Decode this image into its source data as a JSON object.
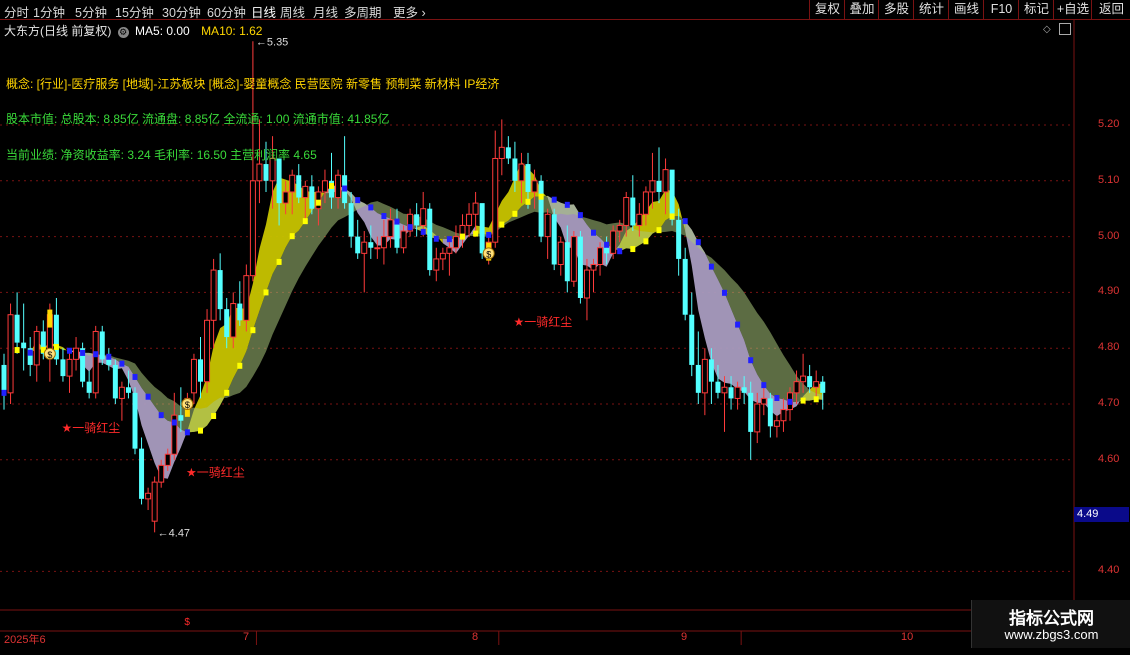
{
  "toolbar": {
    "periods": [
      "分时",
      "1分钟",
      "5分钟",
      "15分钟",
      "30分钟",
      "60分钟",
      "日线",
      "周线",
      "月线",
      "多周期",
      "更多"
    ],
    "active_period": "日线",
    "right_buttons": [
      "复权",
      "叠加",
      "多股",
      "统计",
      "画线",
      "F10",
      "标记",
      "+自选",
      "返回"
    ]
  },
  "header": {
    "stock_title": "大东方(日线 前复权)",
    "ma5_label": "MA5: 0.00",
    "ma10_label": "MA10: 1.62"
  },
  "info": {
    "concepts": "概念: [行业]-医疗服务 [地域]-江苏板块 [概念]-婴童概念 民营医院 新零售 预制菜 新材料 IP经济",
    "capital": "股本市值: 总股本: 8.85亿 流通盘: 8.85亿 全流通: 1.00 流通市值: 41.85亿",
    "performance": "当前业绩: 净资收益率: 3.24 毛利率: 16.50 主营利润率 4.65"
  },
  "annotations": {
    "high_label": "5.35",
    "low_label": "4.47",
    "signal_text": "★一骑红尘",
    "coin_symbol": "$"
  },
  "axis": {
    "y_ticks": [
      "5.20",
      "5.10",
      "5.00",
      "4.90",
      "4.80",
      "4.70",
      "4.60",
      "4.40"
    ],
    "current_price": "4.49",
    "x_labels": [
      "2025年6",
      "7",
      "8",
      "9",
      "10"
    ]
  },
  "watermark": {
    "line1": "指标公式网",
    "line2": "www.zbgs3.com"
  },
  "colors": {
    "up": "#ff3b3b",
    "down": "#54ffff",
    "yellow_candle": "#ffd700",
    "grid": "#7a1212",
    "ribbon_yellow": "#c8c400",
    "ribbon_green": "#7fd08a",
    "ribbon_olive": "#a7c47a",
    "ribbon_lavender": "#a99cc0",
    "dot_blue": "#2020ff",
    "dot_yellow": "#ffff00",
    "text_yellow": "#ffd400",
    "text_green": "#3adb3a"
  },
  "chart_data": {
    "type": "candlestick",
    "ylim": [
      4.35,
      5.45
    ],
    "y_ticks": [
      5.2,
      5.1,
      5.0,
      4.9,
      4.8,
      4.7,
      4.6,
      4.4
    ],
    "months": [
      "2025年6",
      "7",
      "8",
      "9",
      "10"
    ],
    "month_start_index": [
      0,
      39,
      76,
      113,
      158
    ],
    "candles_ohlc": [
      [
        4.77,
        4.79,
        4.69,
        4.72
      ],
      [
        4.72,
        4.88,
        4.7,
        4.86
      ],
      [
        4.86,
        4.9,
        4.79,
        4.81
      ],
      [
        4.81,
        4.88,
        4.76,
        4.8
      ],
      [
        4.8,
        4.82,
        4.75,
        4.77
      ],
      [
        4.77,
        4.84,
        4.74,
        4.83
      ],
      [
        4.83,
        4.85,
        4.78,
        4.79
      ],
      [
        4.79,
        4.88,
        4.74,
        4.86
      ],
      [
        4.86,
        4.89,
        4.77,
        4.78
      ],
      [
        4.78,
        4.8,
        4.74,
        4.75
      ],
      [
        4.75,
        4.8,
        4.72,
        4.78
      ],
      [
        4.78,
        4.82,
        4.76,
        4.8
      ],
      [
        4.8,
        4.81,
        4.73,
        4.74
      ],
      [
        4.74,
        4.76,
        4.71,
        4.72
      ],
      [
        4.72,
        4.84,
        4.71,
        4.83
      ],
      [
        4.83,
        4.84,
        4.77,
        4.78
      ],
      [
        4.78,
        4.8,
        4.76,
        4.77
      ],
      [
        4.77,
        4.78,
        4.7,
        4.71
      ],
      [
        4.71,
        4.74,
        4.67,
        4.73
      ],
      [
        4.73,
        4.76,
        4.71,
        4.72
      ],
      [
        4.72,
        4.73,
        4.61,
        4.62
      ],
      [
        4.62,
        4.64,
        4.52,
        4.53
      ],
      [
        4.53,
        4.55,
        4.51,
        4.54
      ],
      [
        4.49,
        4.57,
        4.47,
        4.56
      ],
      [
        4.56,
        4.6,
        4.55,
        4.59
      ],
      [
        4.59,
        4.62,
        4.58,
        4.61
      ],
      [
        4.61,
        4.72,
        4.6,
        4.68
      ],
      [
        4.68,
        4.73,
        4.65,
        4.67
      ],
      [
        4.7,
        4.72,
        4.68,
        4.71
      ],
      [
        4.72,
        4.79,
        4.7,
        4.78
      ],
      [
        4.78,
        4.82,
        4.71,
        4.74
      ],
      [
        4.74,
        4.87,
        4.72,
        4.85
      ],
      [
        4.85,
        4.96,
        4.8,
        4.94
      ],
      [
        4.94,
        4.97,
        4.85,
        4.87
      ],
      [
        4.87,
        4.89,
        4.8,
        4.82
      ],
      [
        4.82,
        4.9,
        4.8,
        4.88
      ],
      [
        4.88,
        4.92,
        4.84,
        4.85
      ],
      [
        4.85,
        4.95,
        4.83,
        4.93
      ],
      [
        4.93,
        5.35,
        4.92,
        5.1
      ],
      [
        5.1,
        5.21,
        5.06,
        5.13
      ],
      [
        5.13,
        5.17,
        5.08,
        5.1
      ],
      [
        5.1,
        5.18,
        5.05,
        5.14
      ],
      [
        5.14,
        5.12,
        5.02,
        5.06
      ],
      [
        5.06,
        5.1,
        5.04,
        5.08
      ],
      [
        5.08,
        5.12,
        5.04,
        5.11
      ],
      [
        5.11,
        5.13,
        5.06,
        5.07
      ],
      [
        5.07,
        5.1,
        5.03,
        5.09
      ],
      [
        5.09,
        5.11,
        5.04,
        5.05
      ],
      [
        5.05,
        5.09,
        5.02,
        5.08
      ],
      [
        5.08,
        5.12,
        5.06,
        5.1
      ],
      [
        5.1,
        5.15,
        5.05,
        5.07
      ],
      [
        5.07,
        5.12,
        5.05,
        5.11
      ],
      [
        5.11,
        5.18,
        5.05,
        5.06
      ],
      [
        5.06,
        5.08,
        4.98,
        5.0
      ],
      [
        5.0,
        5.03,
        4.96,
        4.97
      ],
      [
        4.97,
        5.01,
        4.9,
        4.99
      ],
      [
        4.99,
        5.02,
        4.96,
        4.98
      ],
      [
        4.98,
        5.0,
        4.96,
        4.98
      ],
      [
        4.98,
        5.03,
        4.95,
        5.0
      ],
      [
        5.0,
        5.05,
        4.98,
        5.03
      ],
      [
        5.03,
        5.05,
        4.97,
        4.98
      ],
      [
        4.98,
        5.02,
        4.97,
        5.01
      ],
      [
        5.01,
        5.05,
        5.0,
        5.04
      ],
      [
        5.04,
        5.06,
        5.0,
        5.02
      ],
      [
        5.02,
        5.08,
        5.0,
        5.05
      ],
      [
        5.05,
        5.06,
        4.93,
        4.94
      ],
      [
        4.94,
        4.98,
        4.92,
        4.96
      ],
      [
        4.96,
        4.98,
        4.94,
        4.97
      ],
      [
        4.97,
        5.0,
        4.93,
        4.98
      ],
      [
        4.98,
        5.02,
        4.97,
        5.0
      ],
      [
        5.0,
        5.04,
        4.98,
        5.02
      ],
      [
        5.02,
        5.06,
        5.0,
        5.04
      ],
      [
        5.04,
        5.08,
        5.01,
        5.06
      ],
      [
        5.06,
        5.05,
        4.96,
        4.97
      ],
      [
        4.97,
        5.0,
        4.95,
        4.99
      ],
      [
        4.99,
        5.19,
        4.98,
        5.14
      ],
      [
        5.14,
        5.21,
        5.11,
        5.16
      ],
      [
        5.16,
        5.18,
        5.13,
        5.14
      ],
      [
        5.14,
        5.17,
        5.08,
        5.1
      ],
      [
        5.1,
        5.15,
        5.06,
        5.13
      ],
      [
        5.13,
        5.15,
        5.05,
        5.08
      ],
      [
        5.08,
        5.12,
        5.05,
        5.1
      ],
      [
        5.1,
        5.11,
        4.99,
        5.0
      ],
      [
        5.0,
        5.05,
        4.96,
        5.04
      ],
      [
        5.04,
        5.05,
        4.94,
        4.95
      ],
      [
        4.95,
        5.0,
        4.93,
        4.99
      ],
      [
        4.99,
        5.02,
        4.9,
        4.92
      ],
      [
        4.92,
        5.01,
        4.91,
        5.0
      ],
      [
        5.0,
        5.01,
        4.88,
        4.89
      ],
      [
        4.89,
        4.96,
        4.85,
        4.94
      ],
      [
        4.94,
        4.96,
        4.9,
        4.95
      ],
      [
        4.95,
        4.99,
        4.93,
        4.98
      ],
      [
        4.98,
        5.0,
        4.95,
        4.97
      ],
      [
        4.97,
        5.02,
        4.96,
        5.01
      ],
      [
        5.01,
        5.03,
        4.99,
        5.02
      ],
      [
        5.02,
        5.08,
        5.0,
        5.07
      ],
      [
        5.07,
        5.11,
        5.01,
        5.02
      ],
      [
        5.02,
        5.06,
        5.0,
        5.04
      ],
      [
        5.04,
        5.09,
        5.02,
        5.08
      ],
      [
        5.08,
        5.15,
        5.05,
        5.1
      ],
      [
        5.1,
        5.16,
        5.06,
        5.08
      ],
      [
        5.08,
        5.14,
        5.04,
        5.12
      ],
      [
        5.12,
        5.11,
        5.02,
        5.03
      ],
      [
        5.03,
        5.05,
        4.93,
        4.96
      ],
      [
        4.96,
        4.98,
        4.85,
        4.86
      ],
      [
        4.86,
        4.9,
        4.75,
        4.77
      ],
      [
        4.77,
        4.83,
        4.7,
        4.72
      ],
      [
        4.72,
        4.8,
        4.68,
        4.78
      ],
      [
        4.78,
        4.8,
        4.7,
        4.74
      ],
      [
        4.74,
        4.77,
        4.71,
        4.72
      ],
      [
        4.72,
        4.75,
        4.65,
        4.73
      ],
      [
        4.73,
        4.75,
        4.69,
        4.71
      ],
      [
        4.71,
        4.74,
        4.69,
        4.73
      ],
      [
        4.73,
        4.75,
        4.7,
        4.72
      ],
      [
        4.72,
        4.74,
        4.6,
        4.65
      ],
      [
        4.65,
        4.72,
        4.63,
        4.7
      ],
      [
        4.7,
        4.73,
        4.68,
        4.71
      ],
      [
        4.71,
        4.72,
        4.64,
        4.66
      ],
      [
        4.66,
        4.68,
        4.64,
        4.67
      ],
      [
        4.67,
        4.71,
        4.65,
        4.69
      ],
      [
        4.69,
        4.73,
        4.67,
        4.72
      ],
      [
        4.72,
        4.76,
        4.7,
        4.74
      ],
      [
        4.74,
        4.79,
        4.72,
        4.75
      ],
      [
        4.75,
        4.77,
        4.72,
        4.73
      ],
      [
        4.73,
        4.76,
        4.71,
        4.74
      ],
      [
        4.74,
        4.75,
        4.69,
        4.72
      ]
    ],
    "high_marker": {
      "value": 5.35,
      "index": 38
    },
    "low_marker": {
      "value": 4.47,
      "index": 23
    },
    "signal_markers": [
      {
        "index": 10,
        "price": 4.65
      },
      {
        "index": 29,
        "price": 4.57
      },
      {
        "index": 79,
        "price": 4.84
      }
    ],
    "coin_markers": [
      {
        "index": 7,
        "price": 4.79
      },
      {
        "index": 28,
        "price": 4.7
      },
      {
        "index": 74,
        "price": 4.97
      }
    ]
  }
}
